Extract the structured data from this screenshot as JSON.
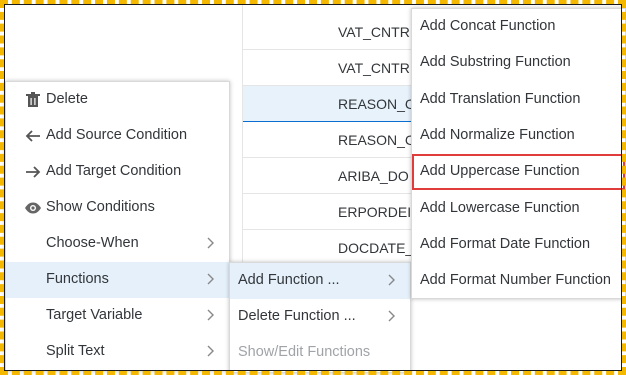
{
  "table": {
    "rows": [
      {
        "text": "VAT_CNTR",
        "selected": false
      },
      {
        "text": "VAT_CNTR",
        "selected": false
      },
      {
        "text": "REASON_C",
        "selected": true
      },
      {
        "text": "REASON_C",
        "selected": false
      },
      {
        "text": "ARIBA_DO",
        "selected": false
      },
      {
        "text": "ERPORDEI",
        "selected": false
      },
      {
        "text": "DOCDATE_",
        "selected": false
      }
    ]
  },
  "context_menu": {
    "items": [
      {
        "label": "Delete",
        "icon": "trash-icon"
      },
      {
        "label": "Add Source Condition",
        "icon": "arrow-left-icon"
      },
      {
        "label": "Add Target Condition",
        "icon": "arrow-right-icon"
      },
      {
        "label": "Show Conditions",
        "icon": "eye-icon"
      },
      {
        "label": "Choose-When",
        "submenu": true
      },
      {
        "label": "Functions",
        "submenu": true,
        "active": true
      },
      {
        "label": "Target Variable",
        "submenu": true
      },
      {
        "label": "Split Text",
        "submenu": true
      }
    ]
  },
  "functions_submenu": {
    "items": [
      {
        "label": "Add Function ...",
        "submenu": true
      },
      {
        "label": "Delete Function ...",
        "submenu": true
      },
      {
        "label": "Show/Edit Functions",
        "disabled": true
      }
    ]
  },
  "add_function_submenu": {
    "items": [
      {
        "label": "Add Concat Function"
      },
      {
        "label": "Add Substring Function"
      },
      {
        "label": "Add Translation Function"
      },
      {
        "label": "Add Normalize Function"
      },
      {
        "label": "Add Uppercase Function",
        "highlighted": true
      },
      {
        "label": "Add Lowercase Function"
      },
      {
        "label": "Add Format Date Function"
      },
      {
        "label": "Add Format Number Function"
      }
    ]
  },
  "colors": {
    "frame_border": "#f5b800",
    "highlight_outline": "#e03c3c",
    "active_item_bg": "#e5f0fa",
    "selected_row_bg": "#e8f2fb",
    "selected_row_line": "#0a6ed1"
  }
}
